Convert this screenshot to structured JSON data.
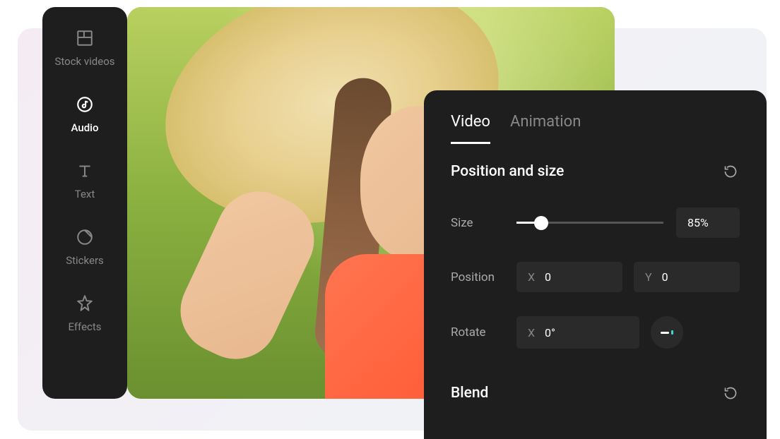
{
  "sidebar": {
    "items": [
      {
        "label": "Stock videos",
        "icon": "template"
      },
      {
        "label": "Audio",
        "icon": "audio"
      },
      {
        "label": "Text",
        "icon": "text"
      },
      {
        "label": "Stickers",
        "icon": "stickers"
      },
      {
        "label": "Effects",
        "icon": "effects"
      }
    ],
    "activeIndex": 1
  },
  "panel": {
    "tabs": [
      {
        "label": "Video"
      },
      {
        "label": "Animation"
      }
    ],
    "activeTab": 0,
    "sections": {
      "position_size": {
        "title": "Position and size",
        "size": {
          "label": "Size",
          "value": "85%",
          "percent": 17
        },
        "position": {
          "label": "Position",
          "x_prefix": "X",
          "x_value": "0",
          "y_prefix": "Y",
          "y_value": "0"
        },
        "rotate": {
          "label": "Rotate",
          "x_prefix": "X",
          "x_value": "0°"
        }
      },
      "blend": {
        "title": "Blend"
      }
    }
  }
}
